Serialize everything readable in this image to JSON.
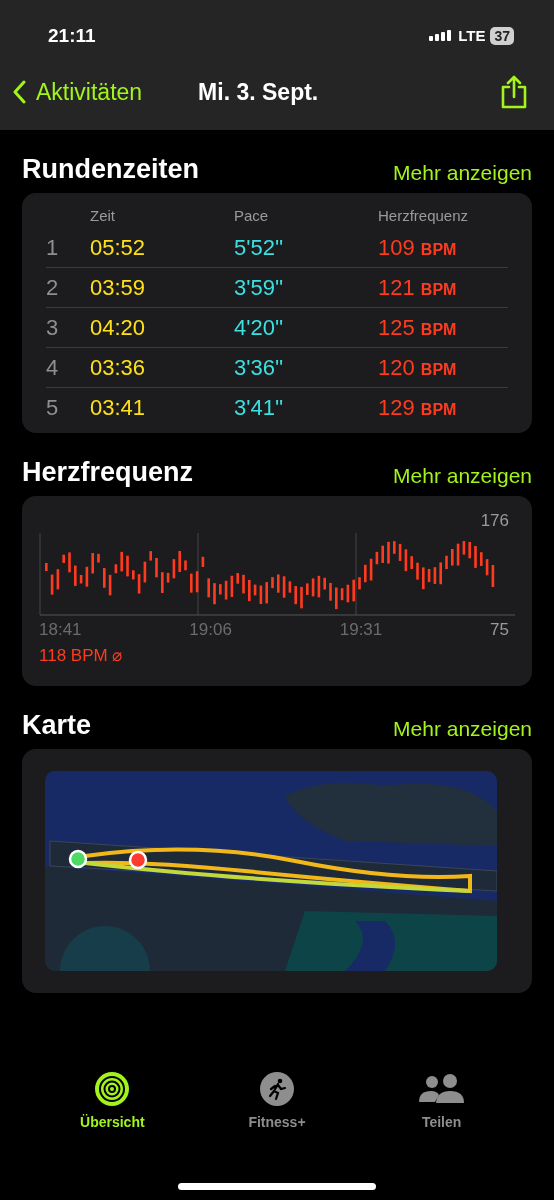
{
  "status_bar": {
    "time": "21:11",
    "network": "LTE",
    "battery": "37"
  },
  "nav": {
    "back": "Aktivitäten",
    "title": "Mi. 3. Sept."
  },
  "laps": {
    "title": "Rundenzeiten",
    "more": "Mehr anzeigen",
    "columns": [
      "Zeit",
      "Pace",
      "Herzfrequenz"
    ],
    "rows": [
      {
        "index": "1",
        "time": "05:52",
        "pace": "5'52''",
        "hr": "109",
        "unit": "BPM"
      },
      {
        "index": "2",
        "time": "03:59",
        "pace": "3'59''",
        "hr": "121",
        "unit": "BPM"
      },
      {
        "index": "3",
        "time": "04:20",
        "pace": "4'20''",
        "hr": "125",
        "unit": "BPM"
      },
      {
        "index": "4",
        "time": "03:36",
        "pace": "3'36''",
        "hr": "120",
        "unit": "BPM"
      },
      {
        "index": "5",
        "time": "03:41",
        "pace": "3'41''",
        "hr": "129",
        "unit": "BPM"
      }
    ]
  },
  "heart_rate": {
    "title": "Herzfrequenz",
    "more": "Mehr anzeigen",
    "max": "176",
    "min": "75",
    "times": [
      "18:41",
      "19:06",
      "19:31"
    ],
    "average": "118 BPM ⌀"
  },
  "map": {
    "title": "Karte",
    "more": "Mehr anzeigen",
    "kind": "picture"
  },
  "tab_bar": [
    {
      "label": "Übersicht",
      "kind": "rings",
      "selected": true
    },
    {
      "label": "Fitness+",
      "kind": "runner",
      "selected": false
    },
    {
      "label": "Teilen",
      "kind": "people",
      "selected": false
    }
  ]
}
